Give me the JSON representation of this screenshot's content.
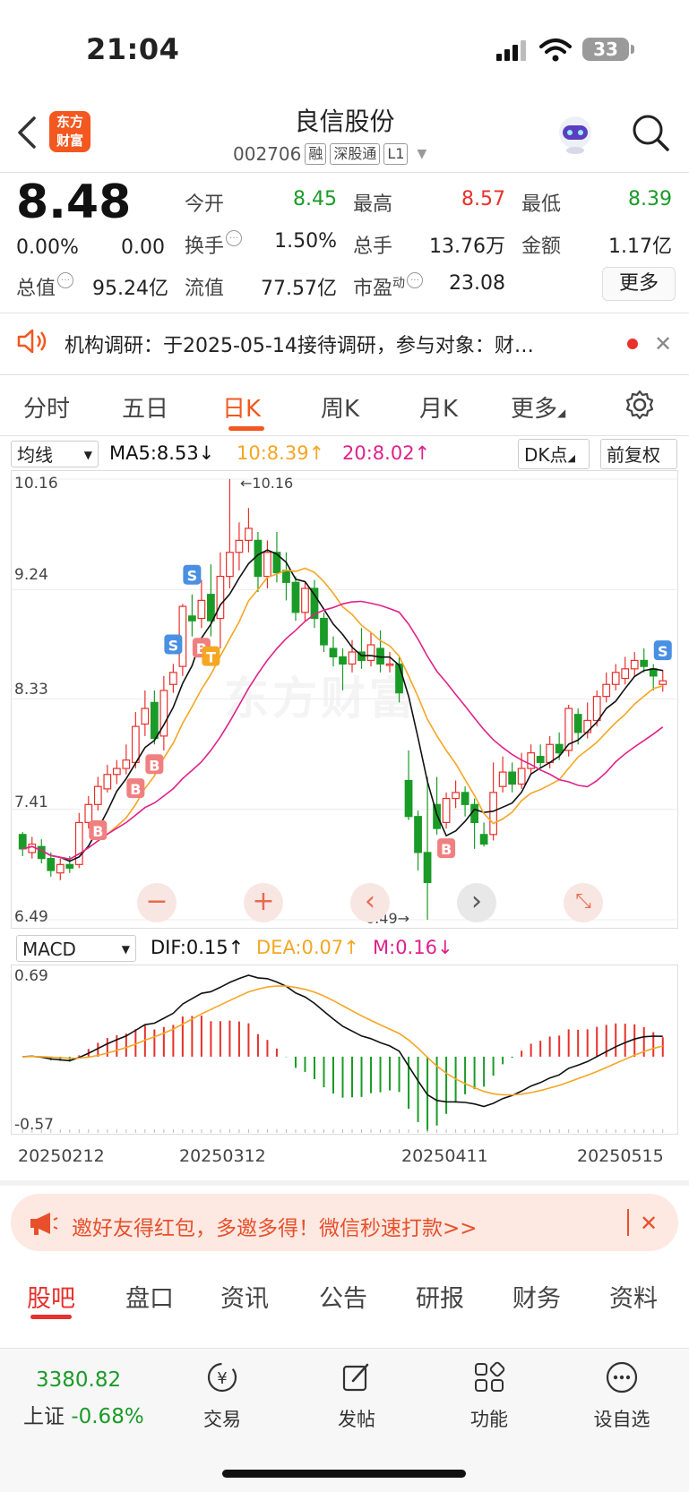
{
  "status": {
    "time": "21:04",
    "battery": "33"
  },
  "header": {
    "name": "良信股份",
    "code": "002706",
    "tags": [
      "融",
      "深股通",
      "L1"
    ],
    "logo": "东方\n财富"
  },
  "quote": {
    "price": "8.48",
    "change_pct": "0.00%",
    "change": "0.00",
    "metrics": [
      {
        "label": "今开",
        "value": "8.45",
        "color": "down"
      },
      {
        "label": "最高",
        "value": "8.57",
        "color": "up"
      },
      {
        "label": "最低",
        "value": "8.39",
        "color": "down"
      },
      {
        "label": "换手",
        "value": "1.50%",
        "color": "neutral"
      },
      {
        "label": "总手",
        "value": "13.76万",
        "color": "neutral"
      },
      {
        "label": "金额",
        "value": "1.17亿",
        "color": "neutral"
      },
      {
        "label": "总值",
        "value": "95.24亿",
        "color": "neutral"
      },
      {
        "label": "流值",
        "value": "77.57亿",
        "color": "neutral"
      },
      {
        "label": "市盈",
        "value": "23.08",
        "color": "neutral"
      }
    ],
    "pe_sup": "动",
    "more": "更多"
  },
  "notice": {
    "text": "机构调研：于2025-05-14接待调研，参与对象：财…"
  },
  "tabs": [
    "分时",
    "五日",
    "日K",
    "周K",
    "月K",
    "更多"
  ],
  "active_tab": "日K",
  "indicators": {
    "ma_select": "均线",
    "ma5": "MA5:8.53↓",
    "ma10": "10:8.39↑",
    "ma20": "20:8.02↑",
    "dk": "DK点",
    "adjust": "前复权",
    "macd_select": "MACD",
    "dif": "DIF:0.15↑",
    "dea": "DEA:0.07↑",
    "m": "M:0.16↓"
  },
  "chart_data": {
    "type": "candlestick",
    "y_ticks": [
      "10.16",
      "9.24",
      "8.33",
      "7.41",
      "6.49"
    ],
    "ylim": [
      6.49,
      10.16
    ],
    "max_label": "10.16",
    "min_label": "6.49",
    "x_ticks": [
      "20250212",
      "20250312",
      "20250411",
      "20250515"
    ],
    "candles": [
      [
        7.2,
        7.08,
        7.22,
        7.02
      ],
      [
        7.05,
        7.12,
        7.18,
        7.0
      ],
      [
        7.1,
        7.0,
        7.16,
        6.96
      ],
      [
        7.0,
        6.9,
        7.05,
        6.85
      ],
      [
        6.88,
        6.95,
        7.0,
        6.82
      ],
      [
        6.95,
        6.92,
        7.02,
        6.88
      ],
      [
        6.95,
        7.3,
        7.38,
        6.92
      ],
      [
        7.3,
        7.45,
        7.52,
        7.25
      ],
      [
        7.45,
        7.6,
        7.68,
        7.4
      ],
      [
        7.58,
        7.7,
        7.78,
        7.55
      ],
      [
        7.7,
        7.75,
        7.82,
        7.62
      ],
      [
        7.75,
        7.82,
        7.95,
        7.7
      ],
      [
        7.8,
        8.1,
        8.22,
        7.75
      ],
      [
        8.12,
        8.25,
        8.4,
        8.02
      ],
      [
        8.3,
        8.0,
        8.4,
        7.95
      ],
      [
        8.02,
        8.4,
        8.52,
        7.9
      ],
      [
        8.45,
        8.55,
        8.62,
        8.38
      ],
      [
        8.6,
        9.1,
        9.12,
        8.52
      ],
      [
        9.02,
        8.98,
        9.2,
        8.85
      ],
      [
        9.0,
        9.15,
        9.32,
        8.92
      ],
      [
        9.2,
        8.98,
        9.45,
        8.85
      ],
      [
        9.0,
        9.35,
        9.55,
        8.75
      ],
      [
        9.35,
        9.55,
        10.16,
        9.25
      ],
      [
        9.55,
        9.65,
        9.8,
        9.4
      ],
      [
        9.65,
        9.75,
        9.92,
        9.55
      ],
      [
        9.65,
        9.35,
        9.72,
        9.22
      ],
      [
        9.35,
        9.55,
        9.65,
        9.25
      ],
      [
        9.55,
        9.38,
        9.72,
        9.3
      ],
      [
        9.4,
        9.3,
        9.55,
        9.15
      ],
      [
        9.3,
        9.05,
        9.35,
        8.98
      ],
      [
        9.05,
        9.25,
        9.3,
        8.98
      ],
      [
        9.25,
        9.0,
        9.32,
        8.92
      ],
      [
        9.0,
        8.78,
        9.05,
        8.72
      ],
      [
        8.75,
        8.68,
        8.85,
        8.6
      ],
      [
        8.68,
        8.62,
        8.75,
        8.4
      ],
      [
        8.62,
        8.72,
        8.82,
        8.55
      ],
      [
        8.72,
        8.65,
        8.92,
        8.58
      ],
      [
        8.65,
        8.78,
        8.88,
        8.6
      ],
      [
        8.75,
        8.62,
        8.9,
        8.55
      ],
      [
        8.62,
        8.62,
        8.72,
        8.55
      ],
      [
        8.62,
        8.38,
        8.68,
        8.3
      ],
      [
        7.65,
        7.35,
        7.9,
        7.32
      ],
      [
        7.35,
        7.05,
        7.4,
        6.9
      ],
      [
        7.05,
        6.8,
        7.68,
        6.49
      ],
      [
        7.45,
        7.25,
        7.68,
        7.2
      ],
      [
        7.3,
        7.5,
        7.55,
        7.25
      ],
      [
        7.5,
        7.55,
        7.65,
        7.42
      ],
      [
        7.55,
        7.45,
        7.6,
        7.35
      ],
      [
        7.45,
        7.3,
        7.5,
        7.08
      ],
      [
        7.2,
        7.12,
        7.3,
        7.1
      ],
      [
        7.2,
        7.55,
        7.8,
        7.15
      ],
      [
        7.6,
        7.72,
        7.85,
        7.55
      ],
      [
        7.72,
        7.62,
        7.8,
        7.55
      ],
      [
        7.62,
        7.75,
        7.88,
        7.58
      ],
      [
        7.75,
        7.88,
        7.95,
        7.7
      ],
      [
        7.85,
        7.8,
        7.95,
        7.75
      ],
      [
        7.8,
        7.95,
        8.02,
        7.75
      ],
      [
        7.95,
        7.88,
        8.05,
        7.82
      ],
      [
        7.9,
        8.25,
        8.28,
        7.85
      ],
      [
        8.2,
        8.05,
        8.25,
        7.95
      ],
      [
        8.05,
        8.15,
        8.3,
        8.0
      ],
      [
        8.15,
        8.35,
        8.4,
        8.1
      ],
      [
        8.35,
        8.45,
        8.55,
        8.3
      ],
      [
        8.45,
        8.55,
        8.62,
        8.4
      ],
      [
        8.5,
        8.58,
        8.68,
        8.45
      ],
      [
        8.58,
        8.65,
        8.72,
        8.52
      ],
      [
        8.65,
        8.6,
        8.75,
        8.55
      ],
      [
        8.58,
        8.52,
        8.62,
        8.4
      ],
      [
        8.45,
        8.48,
        8.57,
        8.39
      ]
    ],
    "signals": [
      {
        "type": "B",
        "i": 8
      },
      {
        "type": "B",
        "i": 12
      },
      {
        "type": "B",
        "i": 14
      },
      {
        "type": "S",
        "i": 16
      },
      {
        "type": "S",
        "i": 18
      },
      {
        "type": "B",
        "i": 19
      },
      {
        "type": "T",
        "i": 20
      },
      {
        "type": "S",
        "i": 22
      },
      {
        "type": "B",
        "i": 43
      },
      {
        "type": "B",
        "i": 45
      },
      {
        "type": "S",
        "i": 68
      }
    ],
    "macd_ticks": [
      "0.69",
      "-0.57"
    ],
    "macd_ylim": [
      -0.57,
      0.69
    ],
    "colors": {
      "up": "#e8302c",
      "down": "#1a9b28",
      "ma5": "#111111",
      "ma10": "#f5a623",
      "ma20": "#e0218a"
    }
  },
  "controls": [
    "-",
    "+",
    "<",
    ">",
    "expand"
  ],
  "promo": {
    "text": "邀好友得红包，多邀多得！微信秒速打款>>"
  },
  "bottom_tabs": [
    "股吧",
    "盘口",
    "资讯",
    "公告",
    "研报",
    "财务",
    "资料"
  ],
  "toolbar": {
    "index_value": "3380.82",
    "index_name": "上证",
    "index_change": "-0.68%",
    "items": [
      {
        "label": "交易",
        "icon": "yen-exchange-icon"
      },
      {
        "label": "发帖",
        "icon": "edit-icon"
      },
      {
        "label": "功能",
        "icon": "grid-icon"
      },
      {
        "label": "设自选",
        "icon": "more-dots-icon"
      }
    ]
  }
}
